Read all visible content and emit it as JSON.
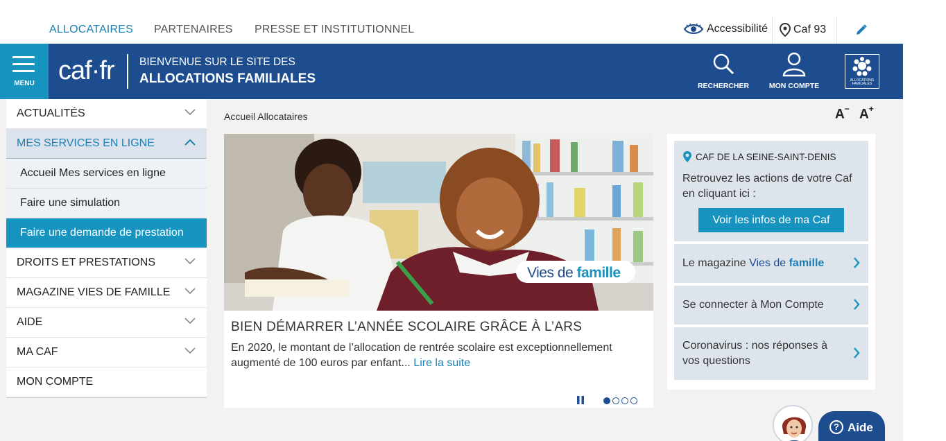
{
  "topnav": {
    "tabs": [
      "ALLOCATAIRES",
      "PARTENAIRES",
      "PRESSE ET INSTITUTIONNEL"
    ],
    "accessibility": "Accessibilité",
    "caf_location": "Caf 93"
  },
  "header": {
    "menu_label": "MENU",
    "logo": "caf·fr",
    "welcome_line1": "BIENVENUE SUR LE SITE DES",
    "welcome_line2": "ALLOCATIONS FAMILIALES",
    "search_label": "RECHERCHER",
    "account_label": "MON COMPTE",
    "emblem_text": "ALLOCATIONS FAMILIALES"
  },
  "sidebar": {
    "items": [
      {
        "label": "ACTUALITÉS"
      },
      {
        "label": "MES SERVICES EN LIGNE"
      },
      {
        "label": "Accueil Mes services en ligne"
      },
      {
        "label": "Faire une simulation"
      },
      {
        "label": "Faire une demande de prestation"
      },
      {
        "label": "DROITS ET PRESTATIONS"
      },
      {
        "label": "MAGAZINE VIES DE FAMILLE"
      },
      {
        "label": "AIDE"
      },
      {
        "label": "MA CAF"
      },
      {
        "label": "MON COMPTE"
      }
    ]
  },
  "main": {
    "breadcrumb": "Accueil Allocataires",
    "font_decrease": "A",
    "font_decrease_sign": "−",
    "font_increase": "A",
    "font_increase_sign": "+",
    "carousel": {
      "badge_vies": "Vies de ",
      "badge_famille": "famille",
      "title": "BIEN DÉMARRER L’ANNÉE SCOLAIRE GRÂCE À L’ARS",
      "text": "En 2020, le montant de l’allocation de rentrée scolaire est exceptionnellement augmenté de 100 euros par enfant... ",
      "read_more": "Lire la suite",
      "slide_count": 4,
      "active_slide": 1
    }
  },
  "panel": {
    "caf_name": "CAF DE LA SEINE-SAINT-DENIS",
    "caf_desc": "Retrouvez les actions de votre Caf en cliquant ici :",
    "caf_button": "Voir les infos de ma Caf",
    "link1_prefix": "Le magazine ",
    "link1_vies": "Vies de ",
    "link1_famille": "famille",
    "link2": "Se connecter à Mon Compte",
    "link3": "Coronavirus : nos réponses à vos questions"
  },
  "help": {
    "label": "Aide",
    "q": "?"
  },
  "colors": {
    "header_blue": "#1d4d8f",
    "accent_teal": "#1693bf",
    "link_blue": "#1d7fb3",
    "card_gray": "#dee4ec"
  }
}
